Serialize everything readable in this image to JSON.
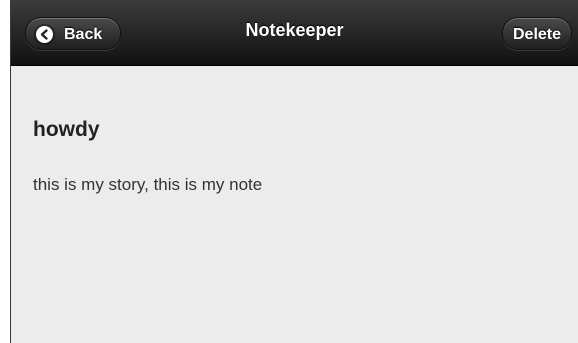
{
  "header": {
    "title": "Notekeeper",
    "back_label": "Back",
    "delete_label": "Delete"
  },
  "icons": {
    "back": "chevron-left-icon"
  },
  "note": {
    "title": "howdy",
    "body": "this is my story, this is my note"
  },
  "colors": {
    "header_bg": "#1a1a1a",
    "page_bg": "#ececec"
  }
}
